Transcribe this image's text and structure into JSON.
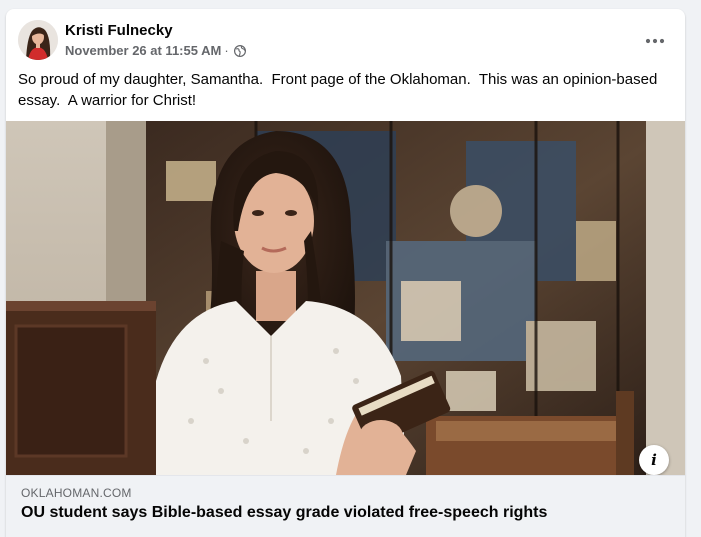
{
  "post": {
    "author": "Kristi Fulnecky",
    "timestamp": "November 26 at 11:55 AM",
    "separator": "·",
    "audience_icon": "globe-icon",
    "more_icon": "more-options-icon",
    "text": "So proud of my daughter, Samantha.  Front page of the Oklahoman.  This was an opinion-based essay.  A warrior for Christ!"
  },
  "link": {
    "domain": "OKLAHOMAN.COM",
    "title": "OU student says Bible-based essay grade violated free-speech rights",
    "info_icon": "info-icon",
    "info_label": "i"
  },
  "colors": {
    "background": "#f0f2f5",
    "card": "#ffffff",
    "primary_text": "#050505",
    "secondary_text": "#65676b"
  }
}
